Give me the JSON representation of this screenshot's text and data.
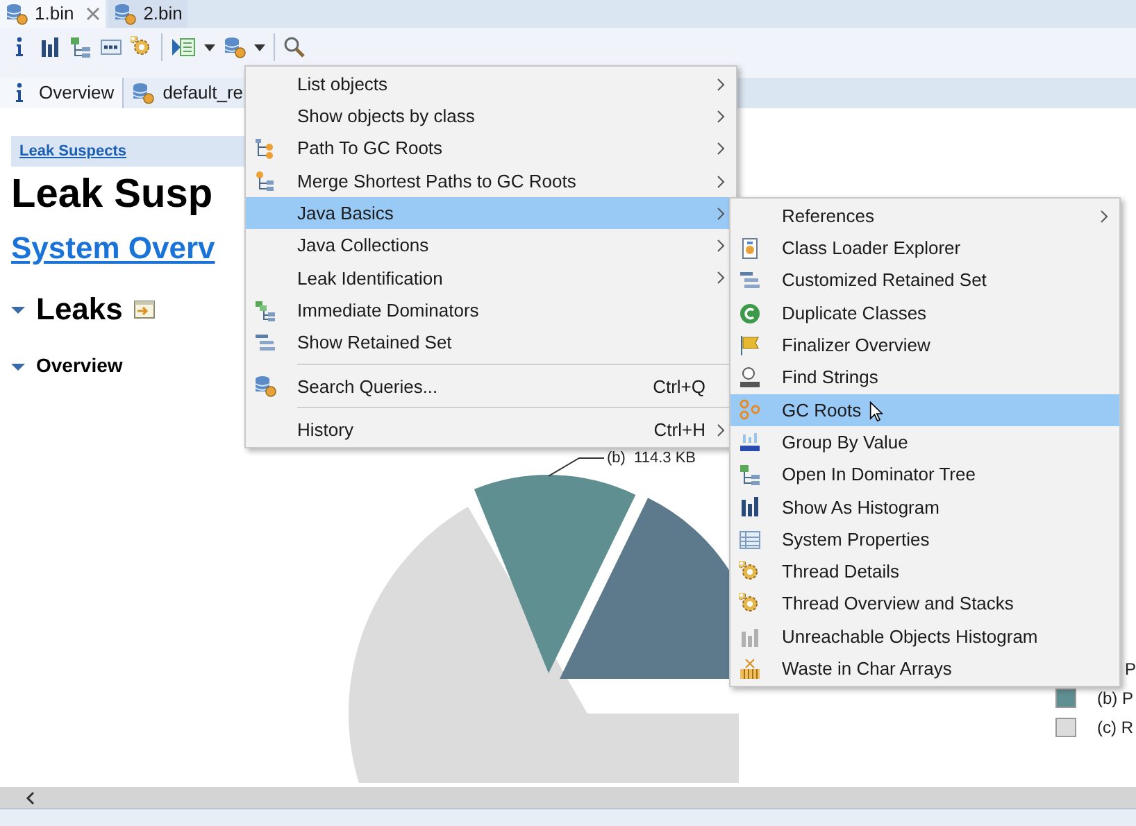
{
  "file_tabs": [
    {
      "label": "1.bin",
      "selected": true,
      "closable": true
    },
    {
      "label": "2.bin",
      "selected": false,
      "closable": false
    }
  ],
  "editor_tabs": [
    {
      "label": "Overview",
      "kind": "info",
      "selected": true
    },
    {
      "label": "default_re",
      "kind": "query",
      "selected": false
    }
  ],
  "report": {
    "breadcrumb": "Leak Suspects",
    "title": "Leak Susp",
    "system_link": "System Overv",
    "sections": [
      {
        "label": "Leaks",
        "kind": "section",
        "expanded": true
      },
      {
        "label": "Overview",
        "kind": "subsection",
        "expanded": true
      }
    ],
    "chart_label": "(b)  114.3 KB",
    "legend": [
      {
        "label": "P"
      },
      {
        "label": "(b) P",
        "color": "#5f8f91"
      },
      {
        "label": "(c) R",
        "color": "#dcdcdc"
      }
    ]
  },
  "menu": {
    "groups": [
      [
        {
          "label": "List objects",
          "kind": "plain",
          "submenu": true,
          "selected": false
        },
        {
          "label": "Show objects by class",
          "kind": "plain",
          "submenu": true,
          "selected": false
        },
        {
          "label": "Path To GC Roots",
          "kind": "path",
          "submenu": true,
          "selected": false
        },
        {
          "label": "Merge Shortest Paths to GC Roots",
          "kind": "merge",
          "submenu": true,
          "selected": false
        },
        {
          "label": "Java Basics",
          "kind": "plain",
          "submenu": true,
          "selected": true
        },
        {
          "label": "Java Collections",
          "kind": "plain",
          "submenu": true,
          "selected": false
        },
        {
          "label": "Leak Identification",
          "kind": "plain",
          "submenu": true,
          "selected": false
        },
        {
          "label": "Immediate Dominators",
          "kind": "dominators",
          "submenu": false,
          "selected": false
        },
        {
          "label": "Show Retained Set",
          "kind": "retained",
          "submenu": false,
          "selected": false
        }
      ],
      [
        {
          "label": "Search Queries...",
          "kind": "query",
          "shortcut": "Ctrl+Q",
          "submenu": false,
          "selected": false
        }
      ],
      [
        {
          "label": "History",
          "kind": "plain",
          "shortcut": "Ctrl+H",
          "submenu": true,
          "selected": false
        }
      ]
    ]
  },
  "submenu": {
    "items": [
      {
        "label": "References",
        "kind": "plain",
        "submenu": true,
        "selected": false
      },
      {
        "label": "Class Loader Explorer",
        "kind": "classloader",
        "submenu": false,
        "selected": false
      },
      {
        "label": "Customized Retained Set",
        "kind": "retained",
        "submenu": false,
        "selected": false
      },
      {
        "label": "Duplicate Classes",
        "kind": "duplicate",
        "submenu": false,
        "selected": false
      },
      {
        "label": "Finalizer Overview",
        "kind": "finalizer",
        "submenu": false,
        "selected": false
      },
      {
        "label": "Find Strings",
        "kind": "strings",
        "submenu": false,
        "selected": false
      },
      {
        "label": "GC Roots",
        "kind": "roots",
        "submenu": false,
        "selected": true
      },
      {
        "label": "Group By Value",
        "kind": "group",
        "submenu": false,
        "selected": false
      },
      {
        "label": "Open In Dominator Tree",
        "kind": "domtree",
        "submenu": false,
        "selected": false
      },
      {
        "label": "Show As Histogram",
        "kind": "histogram",
        "submenu": false,
        "selected": false
      },
      {
        "label": "System Properties",
        "kind": "properties",
        "submenu": false,
        "selected": false
      },
      {
        "label": "Thread Details",
        "kind": "thread",
        "submenu": false,
        "selected": false
      },
      {
        "label": "Thread Overview and Stacks",
        "kind": "thread",
        "submenu": false,
        "selected": false
      },
      {
        "label": "Unreachable Objects Histogram",
        "kind": "unreachable",
        "submenu": false,
        "selected": false
      },
      {
        "label": "Waste in Char Arrays",
        "kind": "waste",
        "submenu": false,
        "selected": false
      }
    ]
  }
}
